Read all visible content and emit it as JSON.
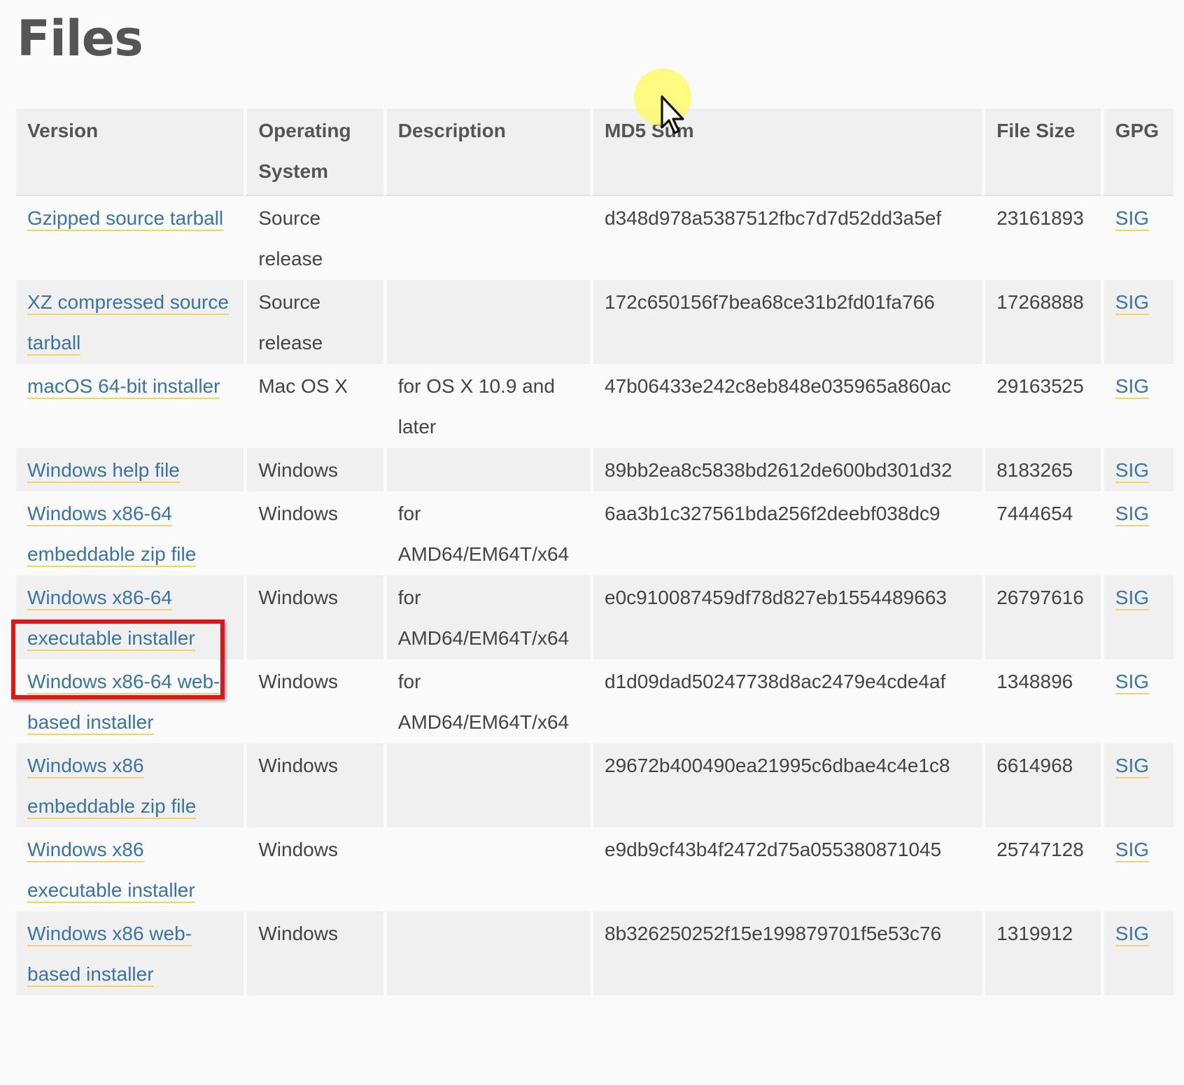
{
  "page": {
    "title": "Files"
  },
  "table": {
    "headers": {
      "version": "Version",
      "os": "Operating System",
      "description": "Description",
      "md5": "MD5 Sum",
      "size": "File Size",
      "gpg": "GPG"
    },
    "rows": [
      {
        "version": "Gzipped source tarball",
        "os": "Source release",
        "description": "",
        "md5": "d348d978a5387512fbc7d7d52dd3a5ef",
        "size": "23161893",
        "gpg": "SIG"
      },
      {
        "version": "XZ compressed source tarball",
        "os": "Source release",
        "description": "",
        "md5": "172c650156f7bea68ce31b2fd01fa766",
        "size": "17268888",
        "gpg": "SIG"
      },
      {
        "version": "macOS 64-bit installer",
        "os": "Mac OS X",
        "description": "for OS X 10.9 and later",
        "md5": "47b06433e242c8eb848e035965a860ac",
        "size": "29163525",
        "gpg": "SIG"
      },
      {
        "version": "Windows help file",
        "os": "Windows",
        "description": "",
        "md5": "89bb2ea8c5838bd2612de600bd301d32",
        "size": "8183265",
        "gpg": "SIG"
      },
      {
        "version": "Windows x86-64 embeddable zip file",
        "os": "Windows",
        "description": "for AMD64/EM64T/x64",
        "md5": "6aa3b1c327561bda256f2deebf038dc9",
        "size": "7444654",
        "gpg": "SIG"
      },
      {
        "version": "Windows x86-64 executable installer",
        "os": "Windows",
        "description": "for AMD64/EM64T/x64",
        "md5": "e0c910087459df78d827eb1554489663",
        "size": "26797616",
        "gpg": "SIG"
      },
      {
        "version": "Windows x86-64 web-based installer",
        "os": "Windows",
        "description": "for AMD64/EM64T/x64",
        "md5": "d1d09dad50247738d8ac2479e4cde4af",
        "size": "1348896",
        "gpg": "SIG"
      },
      {
        "version": "Windows x86 embeddable zip file",
        "os": "Windows",
        "description": "",
        "md5": "29672b400490ea21995c6dbae4c4e1c8",
        "size": "6614968",
        "gpg": "SIG"
      },
      {
        "version": "Windows x86 executable installer",
        "os": "Windows",
        "description": "",
        "md5": "e9db9cf43b4f2472d75a055380871045",
        "size": "25747128",
        "gpg": "SIG"
      },
      {
        "version": "Windows x86 web-based installer",
        "os": "Windows",
        "description": "",
        "md5": "8b326250252f15e199879701f5e53c76",
        "size": "1319912",
        "gpg": "SIG"
      }
    ]
  },
  "annotations": {
    "highlight_color": "#e01515",
    "cursor_halo_color": "#fffa5a",
    "cursor_icon": "mouse-pointer-icon"
  },
  "colors": {
    "link": "#3a73a6",
    "link_underline": "#f1d46a",
    "text": "#444444",
    "header_bg": "#f0f0f0",
    "page_bg": "#fafafa"
  }
}
